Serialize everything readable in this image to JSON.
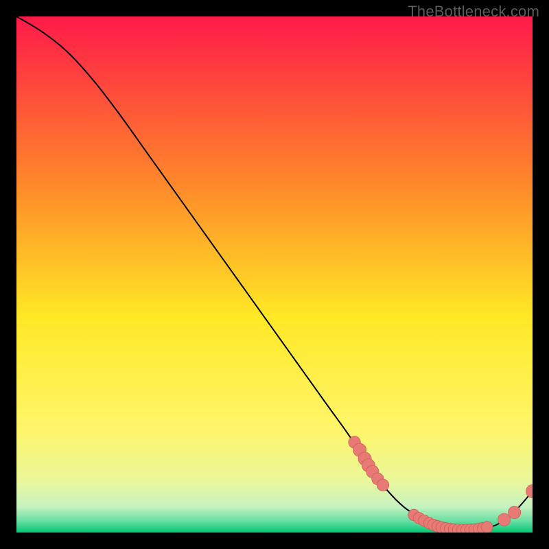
{
  "watermark": "TheBottleneck.com",
  "colors": {
    "bg": "#000000",
    "grad_top": "#ff1a49",
    "grad_upper_mid": "#ff8a2a",
    "grad_mid": "#ffe825",
    "grad_lower_mid": "#eaf79a",
    "grad_band_pale": "#e6f7d0",
    "grad_band_green": "#00c870",
    "curve": "#000000",
    "marker_fill": "#e77a74",
    "marker_stroke": "#c9564e"
  },
  "chart_data": {
    "type": "line",
    "title": "",
    "xlabel": "",
    "ylabel": "",
    "xlim": [
      0,
      100
    ],
    "ylim": [
      0,
      100
    ],
    "series": [
      {
        "name": "bottleneck-curve",
        "x": [
          0,
          5,
          10,
          15,
          20,
          25,
          30,
          35,
          40,
          45,
          50,
          55,
          60,
          65,
          68,
          72,
          75,
          78,
          80,
          82,
          84,
          86,
          88,
          90,
          93,
          96,
          100
        ],
        "y": [
          100,
          97,
          93,
          87.5,
          81,
          74,
          67,
          60,
          53,
          46,
          39,
          32,
          25,
          18,
          13,
          8,
          5,
          3,
          2,
          1.2,
          0.7,
          0.5,
          0.5,
          0.7,
          1.5,
          3.5,
          8
        ]
      }
    ],
    "markers": [
      {
        "x": 65.5,
        "y": 17.5,
        "r": 1.4
      },
      {
        "x": 66.5,
        "y": 16.0,
        "r": 1.6
      },
      {
        "x": 67.5,
        "y": 14.3,
        "r": 1.6
      },
      {
        "x": 68.2,
        "y": 13.0,
        "r": 1.6
      },
      {
        "x": 69.0,
        "y": 11.8,
        "r": 1.5
      },
      {
        "x": 70.0,
        "y": 10.4,
        "r": 1.4
      },
      {
        "x": 71.0,
        "y": 9.2,
        "r": 1.4
      },
      {
        "x": 77.0,
        "y": 3.4,
        "r": 1.3
      },
      {
        "x": 78.0,
        "y": 2.8,
        "r": 1.3
      },
      {
        "x": 79.0,
        "y": 2.3,
        "r": 1.3
      },
      {
        "x": 80.0,
        "y": 1.8,
        "r": 1.3
      },
      {
        "x": 80.8,
        "y": 1.5,
        "r": 1.3
      },
      {
        "x": 81.6,
        "y": 1.2,
        "r": 1.3
      },
      {
        "x": 82.4,
        "y": 1.0,
        "r": 1.3
      },
      {
        "x": 83.2,
        "y": 0.8,
        "r": 1.3
      },
      {
        "x": 84.0,
        "y": 0.7,
        "r": 1.3
      },
      {
        "x": 84.8,
        "y": 0.6,
        "r": 1.3
      },
      {
        "x": 85.6,
        "y": 0.55,
        "r": 1.3
      },
      {
        "x": 86.4,
        "y": 0.5,
        "r": 1.3
      },
      {
        "x": 87.2,
        "y": 0.5,
        "r": 1.3
      },
      {
        "x": 88.0,
        "y": 0.55,
        "r": 1.3
      },
      {
        "x": 88.8,
        "y": 0.6,
        "r": 1.3
      },
      {
        "x": 89.6,
        "y": 0.7,
        "r": 1.3
      },
      {
        "x": 90.4,
        "y": 0.85,
        "r": 1.3
      },
      {
        "x": 91.2,
        "y": 1.05,
        "r": 1.3
      },
      {
        "x": 94.5,
        "y": 2.5,
        "r": 1.5
      },
      {
        "x": 96.5,
        "y": 3.9,
        "r": 1.5
      },
      {
        "x": 100.0,
        "y": 8.0,
        "r": 1.6
      }
    ]
  }
}
